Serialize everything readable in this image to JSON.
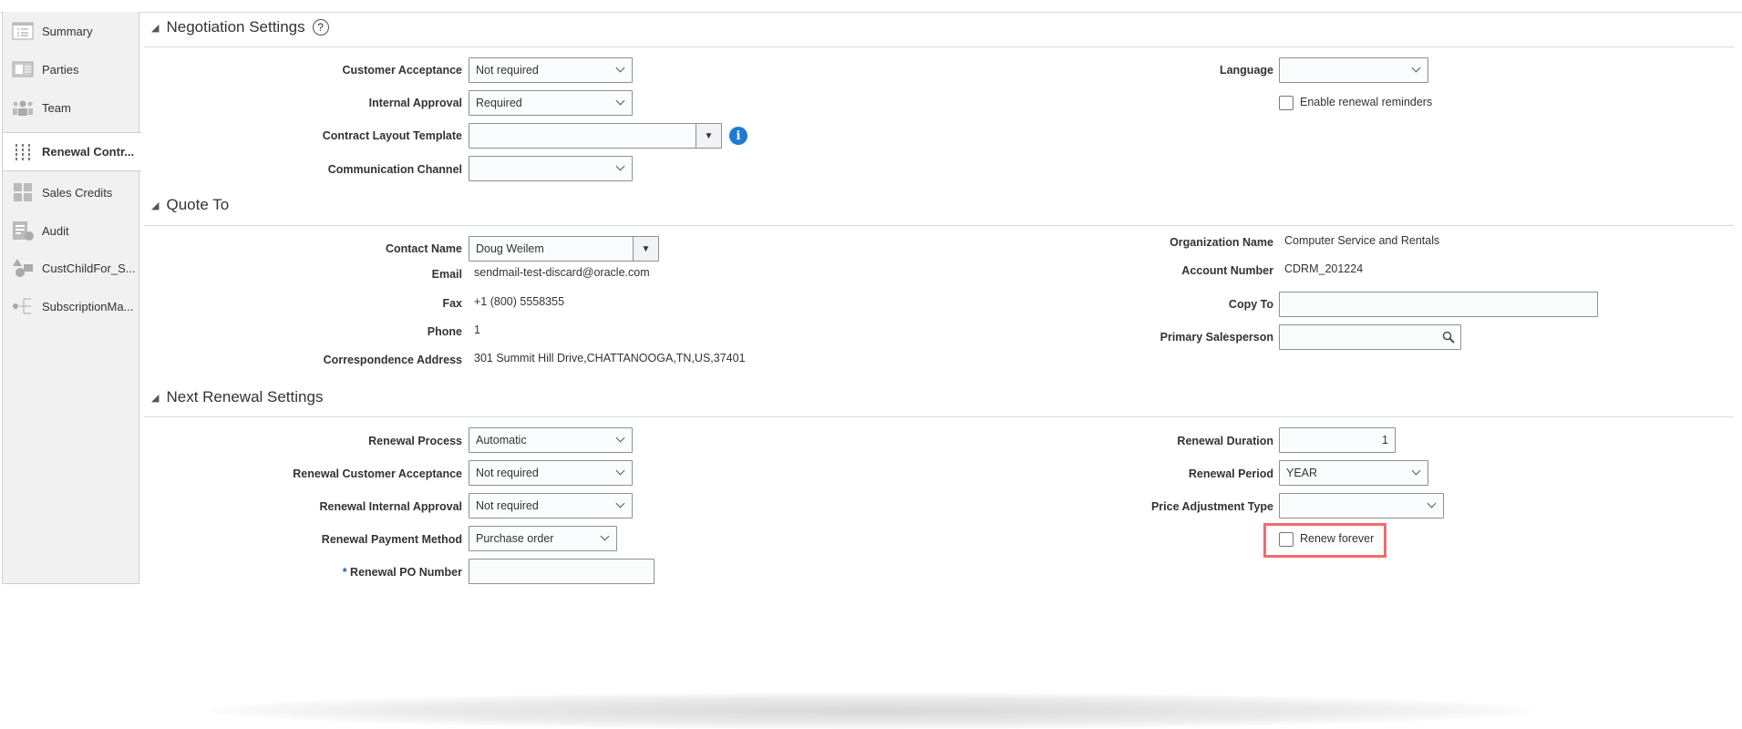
{
  "sidebar": {
    "items": [
      {
        "label": "Summary",
        "icon": "summary-icon"
      },
      {
        "label": "Parties",
        "icon": "parties-icon"
      },
      {
        "label": "Team",
        "icon": "team-icon"
      },
      {
        "label": "Renewal Contr...",
        "icon": "sliders-icon",
        "selected": true
      },
      {
        "label": "Sales Credits",
        "icon": "sales-credits-icon"
      },
      {
        "label": "Audit",
        "icon": "audit-icon"
      },
      {
        "label": "CustChildFor_S...",
        "icon": "shapes-icon"
      },
      {
        "label": "SubscriptionMa...",
        "icon": "hierarchy-icon"
      }
    ]
  },
  "negotiation": {
    "title": "Negotiation Settings",
    "help": "?",
    "customer_acceptance": {
      "label": "Customer Acceptance",
      "value": "Not required"
    },
    "internal_approval": {
      "label": "Internal Approval",
      "value": "Required"
    },
    "contract_layout": {
      "label": "Contract Layout Template",
      "value": "",
      "info": "i"
    },
    "communication_channel": {
      "label": "Communication Channel",
      "value": ""
    },
    "language": {
      "label": "Language",
      "value": ""
    },
    "enable_reminders": {
      "label": "Enable renewal reminders",
      "checked": false
    }
  },
  "quote_to": {
    "title": "Quote To",
    "contact_name": {
      "label": "Contact Name",
      "value": "Doug Weilem"
    },
    "email": {
      "label": "Email",
      "value": "sendmail-test-discard@oracle.com"
    },
    "fax": {
      "label": "Fax",
      "value": "+1 (800) 5558355"
    },
    "phone": {
      "label": "Phone",
      "value": "1"
    },
    "address": {
      "label": "Correspondence Address",
      "value": "301 Summit Hill Drive,CHATTANOOGA,TN,US,37401"
    },
    "organization": {
      "label": "Organization Name",
      "value": "Computer Service and Rentals"
    },
    "account_number": {
      "label": "Account Number",
      "value": "CDRM_201224"
    },
    "copy_to": {
      "label": "Copy To",
      "value": ""
    },
    "primary_salesperson": {
      "label": "Primary Salesperson",
      "value": ""
    }
  },
  "next_renewal": {
    "title": "Next Renewal Settings",
    "process": {
      "label": "Renewal Process",
      "value": "Automatic"
    },
    "customer_acceptance": {
      "label": "Renewal Customer Acceptance",
      "value": "Not required"
    },
    "internal_approval": {
      "label": "Renewal Internal Approval",
      "value": "Not required"
    },
    "payment_method": {
      "label": "Renewal Payment Method",
      "value": "Purchase order"
    },
    "po_number": {
      "label": "Renewal PO Number",
      "required": "*",
      "value": ""
    },
    "duration": {
      "label": "Renewal Duration",
      "value": "1"
    },
    "period": {
      "label": "Renewal Period",
      "value": "YEAR"
    },
    "price_adjustment": {
      "label": "Price Adjustment Type",
      "value": ""
    },
    "renew_forever": {
      "label": "Renew forever",
      "checked": false
    }
  },
  "colors": {
    "highlight": "#f26b6b",
    "info": "#1f7ad6"
  }
}
